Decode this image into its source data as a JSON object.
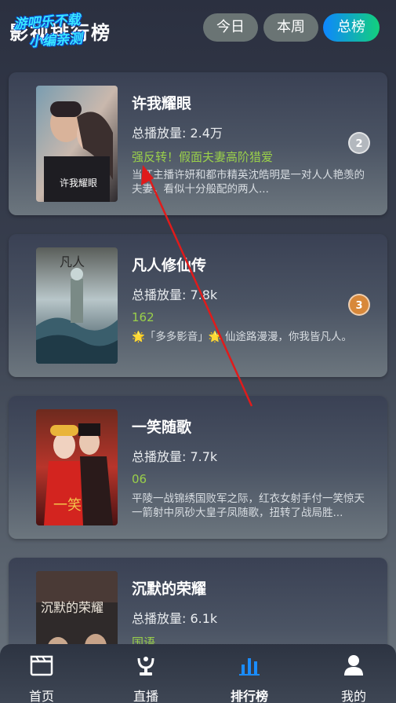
{
  "header": {
    "title": "影视排行榜",
    "watermark_line1": "游吧乐不载",
    "watermark_line2": "小编亲测",
    "tabs": [
      {
        "label": "今日",
        "active": false
      },
      {
        "label": "本周",
        "active": false
      },
      {
        "label": "总榜",
        "active": true
      }
    ]
  },
  "items": [
    {
      "title": "许我耀眼",
      "views": "总播放量: 2.4万",
      "tag": "强反转！假面夫妻高阶猎爱",
      "desc": "当红主播许妍和都市精英沈皓明是一对人人艳羡的夫妻，看似十分般配的两人...",
      "rank": "2",
      "rank_color": "#b3b8be"
    },
    {
      "title": "凡人修仙传",
      "views": "总播放量: 7.8k",
      "tag": "162",
      "desc": "🌟「多多影音」🌟 仙途路漫漫，你我皆凡人。",
      "rank": "3",
      "rank_color": "#d8883a"
    },
    {
      "title": "一笑随歌",
      "views": "总播放量: 7.7k",
      "tag": "06",
      "desc": "平陵一战锦绣国败军之际，红衣女射手付一笑惊天一箭射中夙砂大皇子凤随歌，扭转了战局胜...",
      "rank": "",
      "rank_color": ""
    },
    {
      "title": "沉默的荣耀",
      "views": "总播放量: 6.1k",
      "tag": "国语",
      "desc": "",
      "rank": "",
      "rank_color": ""
    }
  ],
  "bottom_nav": [
    {
      "label": "首页",
      "icon": "clapperboard-icon",
      "active": false
    },
    {
      "label": "直播",
      "icon": "live-award-icon",
      "active": false
    },
    {
      "label": "排行榜",
      "icon": "bar-chart-icon",
      "active": true
    },
    {
      "label": "我的",
      "icon": "user-icon",
      "active": false
    }
  ],
  "colors": {
    "accent_blue": "#0e86ff",
    "accent_green": "#13d07c",
    "tag_green": "#9ad04a",
    "annotation_arrow": "#e01b1b"
  }
}
